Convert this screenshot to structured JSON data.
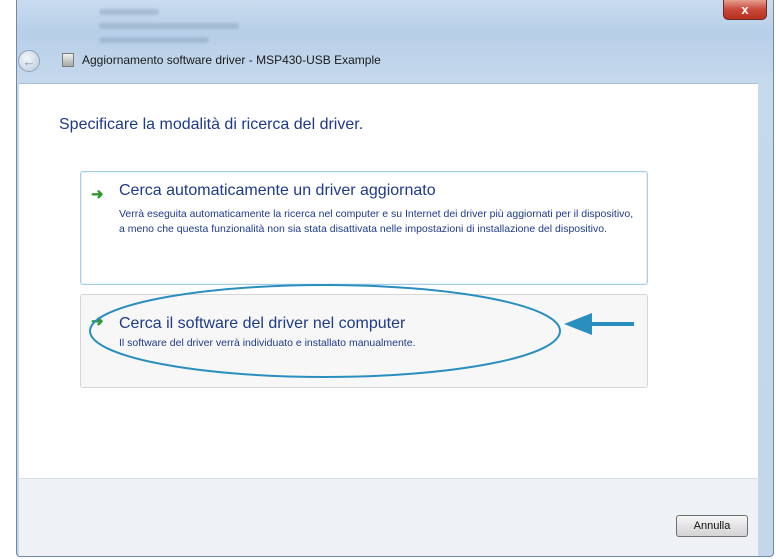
{
  "window": {
    "title": "Aggiornamento software driver - MSP430-USB Example",
    "close_label": "x"
  },
  "heading": "Specificare la modalità di ricerca del driver.",
  "options": [
    {
      "title": "Cerca automaticamente un driver aggiornato",
      "description": "Verrà eseguita automaticamente la ricerca nel computer e su Internet dei driver più aggiornati per il dispositivo, a meno che questa funzionalità non sia stata disattivata nelle impostazioni di installazione del dispositivo."
    },
    {
      "title": "Cerca il software del driver nel computer",
      "description": "Il software del driver verrà individuato e installato manualmente."
    }
  ],
  "footer": {
    "cancel_label": "Annulla"
  },
  "icons": {
    "back": "back-arrow-icon",
    "option_arrow": "green-arrow-icon",
    "close": "close-icon"
  },
  "colors": {
    "heading": "#1e3a8a",
    "option_arrow": "#2e9a2e",
    "annotation": "#2a8fbf"
  }
}
